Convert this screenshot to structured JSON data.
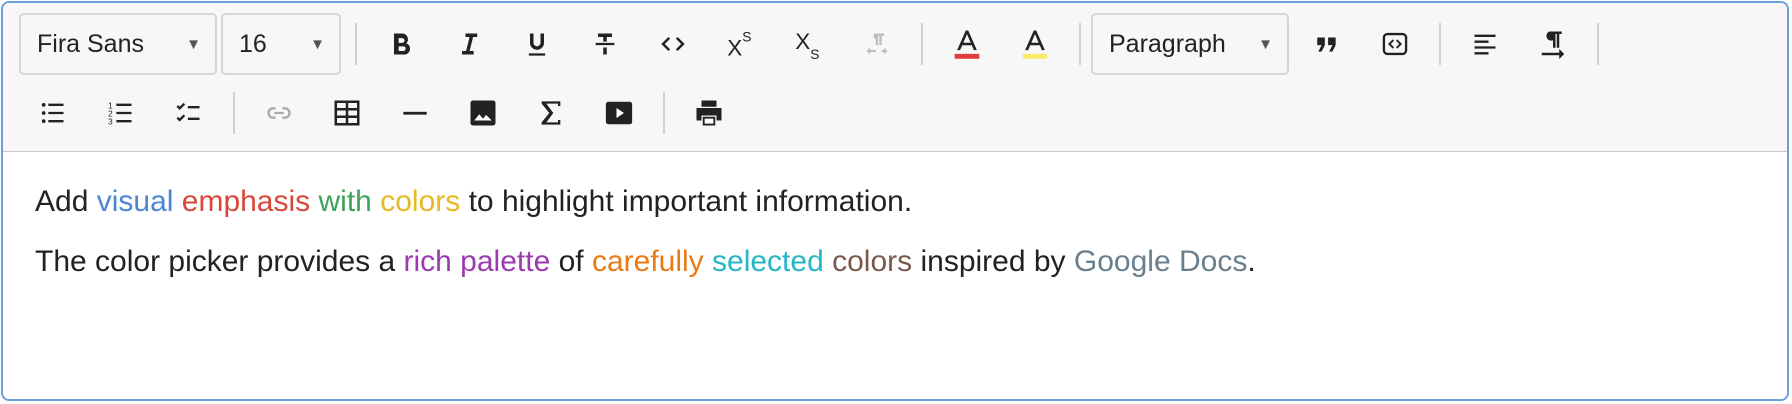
{
  "toolbar": {
    "font_family": "Fira Sans",
    "font_size": "16",
    "block_format": "Paragraph",
    "buttons_row1": [
      "bold-icon",
      "italic-icon",
      "underline-icon",
      "strikethrough-icon",
      "code-icon",
      "superscript-icon",
      "subscript-icon",
      "clear-format-icon",
      "text-color-icon",
      "highlight-color-icon",
      "blockquote-icon",
      "code-block-icon",
      "align-left-icon",
      "text-direction-icon"
    ],
    "buttons_row2": [
      "bullet-list-icon",
      "numbered-list-icon",
      "checklist-icon",
      "link-icon",
      "table-icon",
      "horizontal-rule-icon",
      "image-icon",
      "formula-icon",
      "video-icon",
      "print-icon"
    ],
    "text_color_swatch": "#e03e3e",
    "highlight_swatch": "#fbeb6b"
  },
  "content": {
    "p1": [
      {
        "text": "Add ",
        "color": "#222222"
      },
      {
        "text": "visual",
        "color": "#4a86d4"
      },
      {
        "text": " ",
        "color": "#222222"
      },
      {
        "text": "emphasis",
        "color": "#d9473a"
      },
      {
        "text": " ",
        "color": "#222222"
      },
      {
        "text": "with",
        "color": "#3da35a"
      },
      {
        "text": " ",
        "color": "#222222"
      },
      {
        "text": "colors",
        "color": "#e6b822"
      },
      {
        "text": " to highlight important information.",
        "color": "#222222"
      }
    ],
    "p2": [
      {
        "text": "The color picker provides a ",
        "color": "#222222"
      },
      {
        "text": "rich palette",
        "color": "#9c3ab0"
      },
      {
        "text": " of ",
        "color": "#222222"
      },
      {
        "text": "carefully",
        "color": "#ea7a14"
      },
      {
        "text": " ",
        "color": "#222222"
      },
      {
        "text": "selected",
        "color": "#25b6c6"
      },
      {
        "text": " ",
        "color": "#222222"
      },
      {
        "text": "colors",
        "color": "#7a5a4d"
      },
      {
        "text": " inspired by ",
        "color": "#222222"
      },
      {
        "text": "Google Docs",
        "color": "#6a7f8d"
      },
      {
        "text": ".",
        "color": "#222222"
      }
    ]
  }
}
